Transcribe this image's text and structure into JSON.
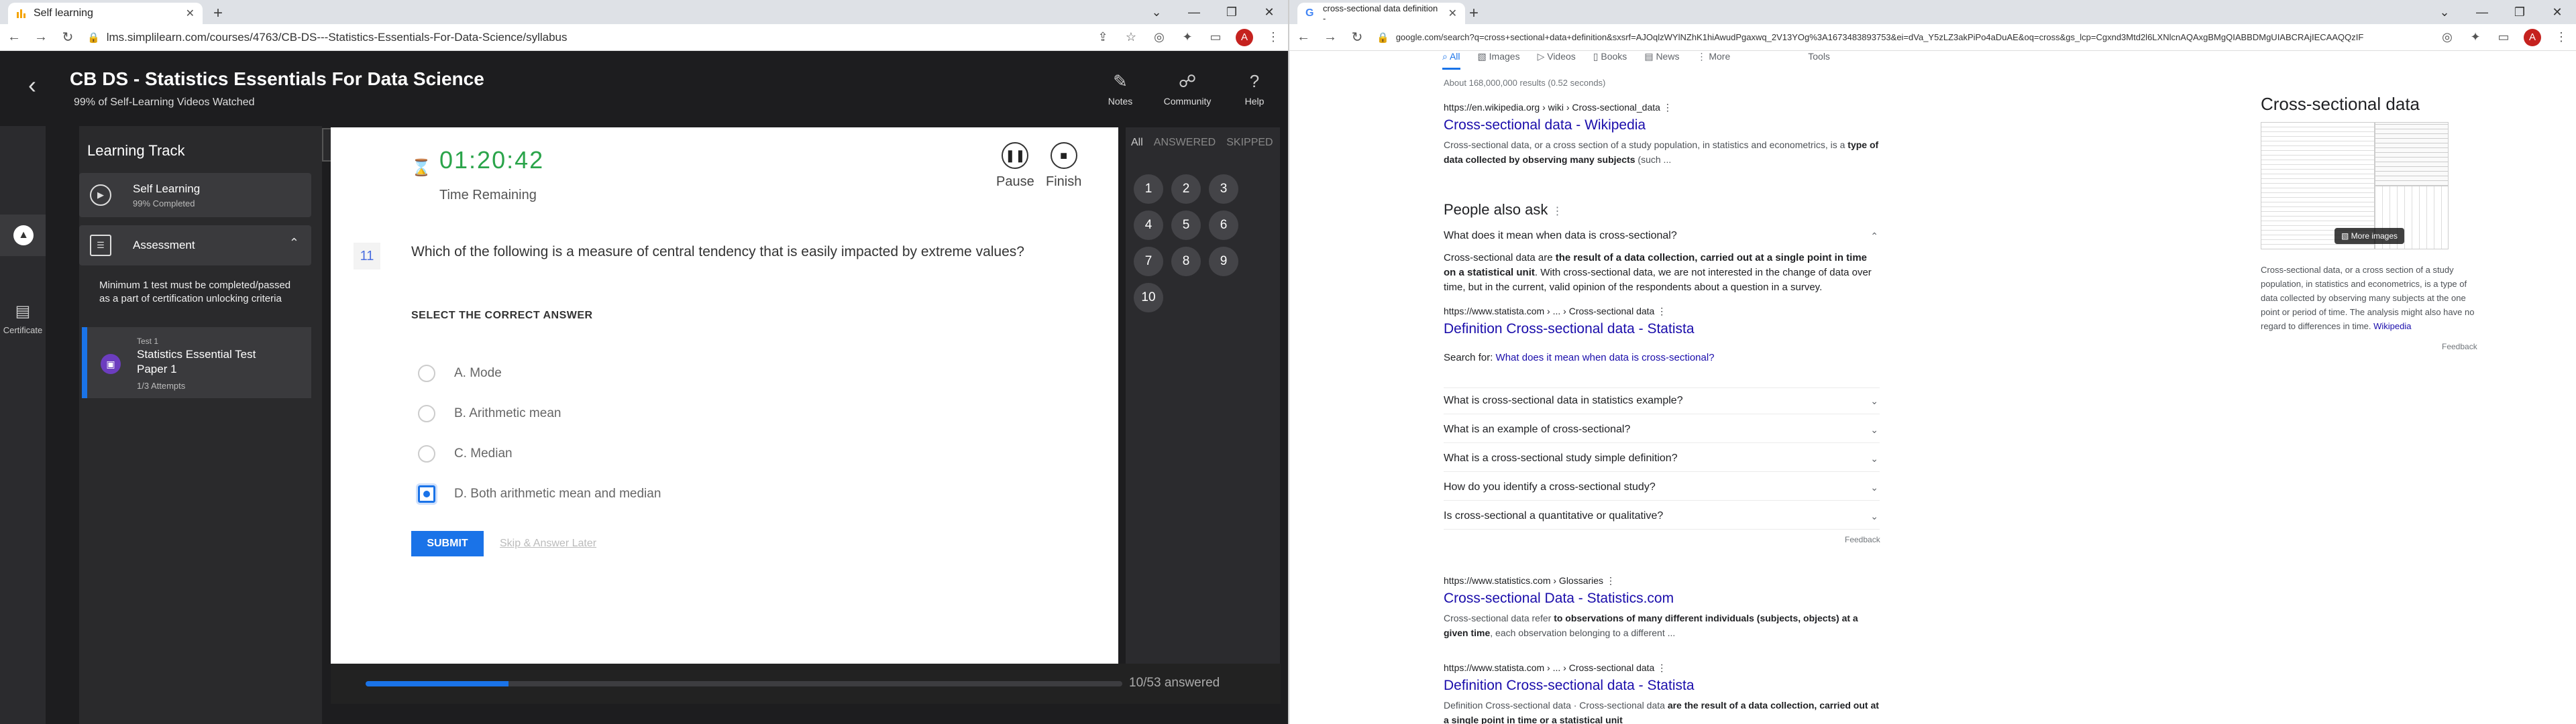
{
  "left_browser": {
    "tab_title": "Self learning",
    "url": "lms.simplilearn.com/courses/4763/CB-DS---Statistics-Essentials-For-Data-Science/syllabus",
    "avatar_letter": "A"
  },
  "course": {
    "title": "CB DS - Statistics Essentials For Data Science",
    "subtitle": "99% of Self-Learning Videos Watched",
    "header_buttons": [
      "Notes",
      "Community",
      "Help"
    ],
    "rail_certificate": "Certificate",
    "track_title": "Learning Track",
    "self_learning": {
      "label": "Self Learning",
      "status": "99% Completed"
    },
    "assessment": {
      "label": "Assessment",
      "note": "Minimum 1 test must be completed/passed as a part of certification unlocking criteria"
    },
    "test": {
      "tag": "Test 1",
      "name": "Statistics Essential Test Paper 1",
      "attempts": "1/3 Attempts"
    }
  },
  "quiz": {
    "timer": "01:20:42",
    "time_label": "Time Remaining",
    "pause_label": "Pause",
    "finish_label": "Finish",
    "question_number": "11",
    "question": "Which of the following is a measure of central tendency that is easily impacted by extreme values?",
    "select_heading": "SELECT THE CORRECT ANSWER",
    "options": [
      {
        "letter": "A.",
        "text": "Mode"
      },
      {
        "letter": "B.",
        "text": "Arithmetic mean"
      },
      {
        "letter": "C.",
        "text": "Median"
      },
      {
        "letter": "D.",
        "text": "Both arithmetic mean and median"
      }
    ],
    "selected_option_index": 3,
    "submit_label": "SUBMIT",
    "skip_label": "Skip & Answer Later",
    "nav_tabs": [
      "All",
      "ANSWERED",
      "SKIPPED"
    ],
    "nav_numbers": [
      "1",
      "2",
      "3",
      "4",
      "5",
      "6",
      "7",
      "8",
      "9",
      "10"
    ],
    "progress_text": "10/53 answered",
    "progress_fraction": 0.1887
  },
  "right_browser": {
    "tab_title": "cross-sectional data definition -",
    "url": "google.com/search?q=cross+sectional+data+definition&sxsrf=AJOqlzWYlNZhK1hiAwudPgaxwq_2V13YOg%3A1673483893753&ei=dVa_Y5zLZ3akPiPo4aDuAE&oq=cross&gs_lcp=Cgxnd3Mtd2l6LXNlcnAQAxgBMgQIABBDMgUIABCRAjIECAAQQzIF",
    "avatar_letter": "A"
  },
  "google": {
    "tabs": [
      "All",
      "Images",
      "Videos",
      "Books",
      "News",
      "More"
    ],
    "tools_label": "Tools",
    "stats": "About 168,000,000 results (0.52 seconds)",
    "result1": {
      "url": "https://en.wikipedia.org › wiki › Cross-sectional_data",
      "title": "Cross-sectional data - Wikipedia",
      "snippet_plain": "Cross-sectional data, or a cross section of a study population, in statistics and econometrics, is a ",
      "snippet_bold": "type of data collected by observing many subjects",
      "snippet_tail": " (such ..."
    },
    "paa_title": "People also ask",
    "paa_open_q": "What does it mean when data is cross-sectional?",
    "paa_answer_pre": "Cross-sectional data are ",
    "paa_answer_bold": "the result of a data collection, carried out at a single point in time on a statistical unit",
    "paa_answer_post": ". With cross-sectional data, we are not interested in the change of data over time, but in the current, valid opinion of the respondents about a question in a survey.",
    "paa_src_url": "https://www.statista.com › ... › Cross-sectional data",
    "paa_src_title": "Definition Cross-sectional data - Statista",
    "search_for_label": "Search for:",
    "search_for_link": "What does it mean when data is cross-sectional?",
    "paa_questions": [
      "What is cross-sectional data in statistics example?",
      "What is an example of cross-sectional?",
      "What is a cross-sectional study simple definition?",
      "How do you identify a cross-sectional study?",
      "Is cross-sectional a quantitative or qualitative?"
    ],
    "feedback": "Feedback",
    "result2": {
      "url": "https://www.statistics.com › Glossaries",
      "title": "Cross-sectional Data - Statistics.com",
      "snippet_plain": "Cross-sectional data refer ",
      "snippet_bold": "to observations of many different individuals (subjects, objects) at a given time",
      "snippet_tail": ", each observation belonging to a different ..."
    },
    "result3": {
      "url": "https://www.statista.com › ... › Cross-sectional data",
      "title": "Definition Cross-sectional data - Statista",
      "snippet_plain": "Definition Cross-sectional data · Cross-sectional data ",
      "snippet_bold": "are the result of a data collection, carried out at a single point in time or a statistical unit",
      "snippet_tail": ""
    },
    "kp_title": "Cross-sectional data",
    "kp_more_images": "More images",
    "kp_desc": "Cross-sectional data, or a cross section of a study population, in statistics and econometrics, is a type of data collected by observing many subjects at the one point or period of time. The analysis might also have no regard to differences in time.",
    "kp_link": "Wikipedia",
    "kp_feedback": "Feedback"
  }
}
